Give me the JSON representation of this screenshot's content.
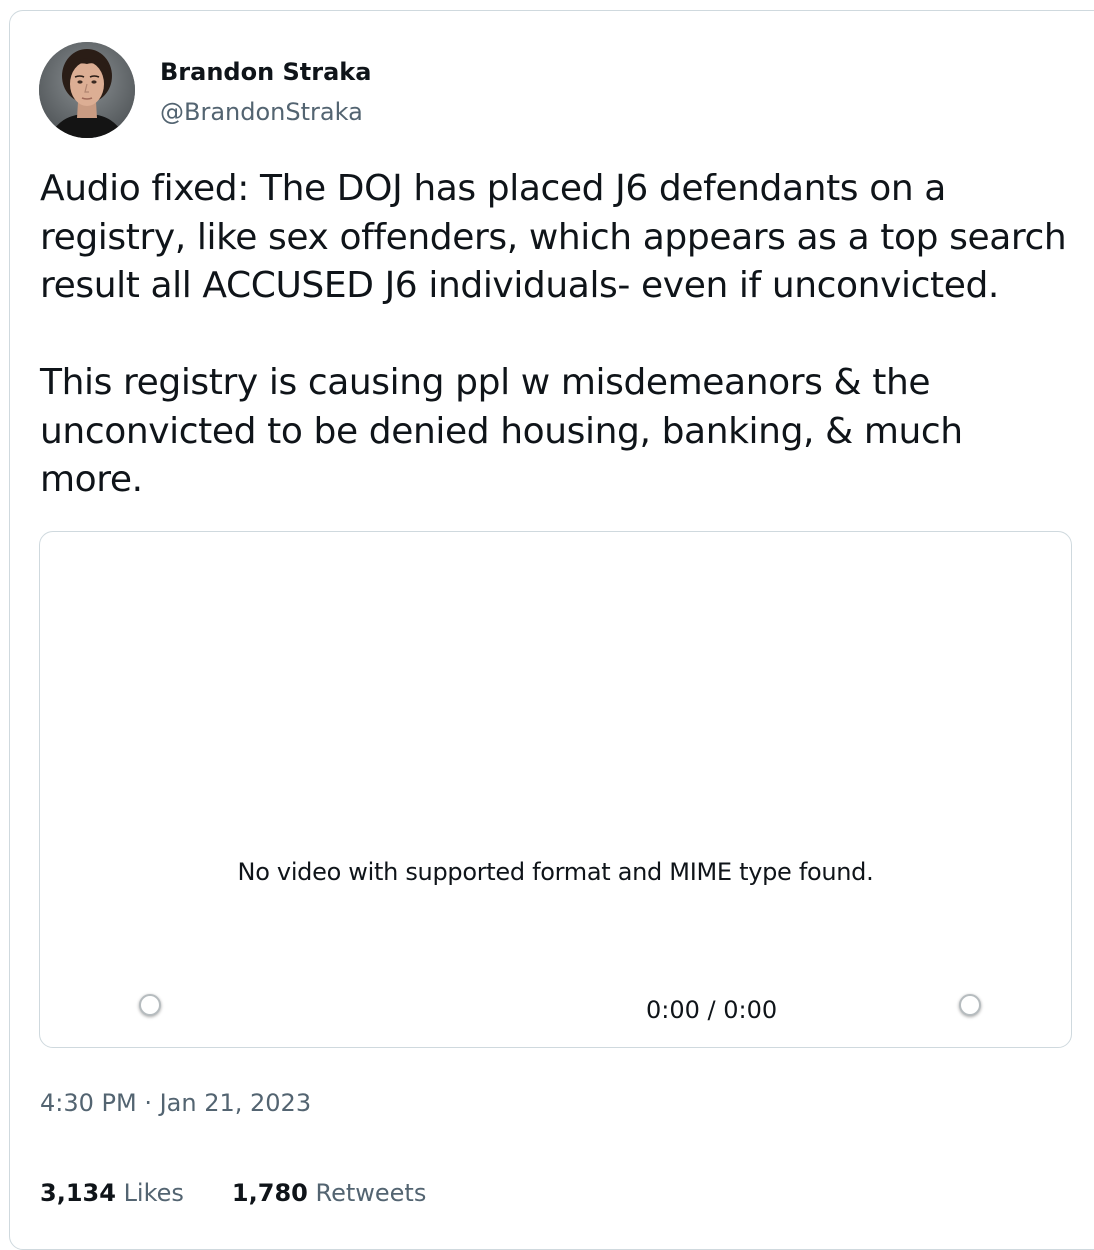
{
  "author": {
    "name": "Brandon Straka",
    "handle": "@BrandonStraka"
  },
  "tweet": {
    "paragraphs": [
      "Audio fixed: The DOJ has placed J6 defendants on a registry, like sex offenders, which appears as a top search result all ACCUSED J6 individuals- even if unconvicted.",
      "This registry is causing ppl w misdemeanors & the unconvicted to be denied housing, banking, & much more."
    ],
    "timestamp": "4:30 PM · Jan 21, 2023"
  },
  "video": {
    "error_message": "No video with supported format and MIME type found.",
    "time_readout": "0:00 / 0:00"
  },
  "stats": {
    "likes_count": "3,134",
    "likes_label": "Likes",
    "retweets_count": "1,780",
    "retweets_label": "Retweets"
  },
  "colors": {
    "text": "#0f1419",
    "secondary_text": "#536471",
    "border": "#cfd9de"
  }
}
